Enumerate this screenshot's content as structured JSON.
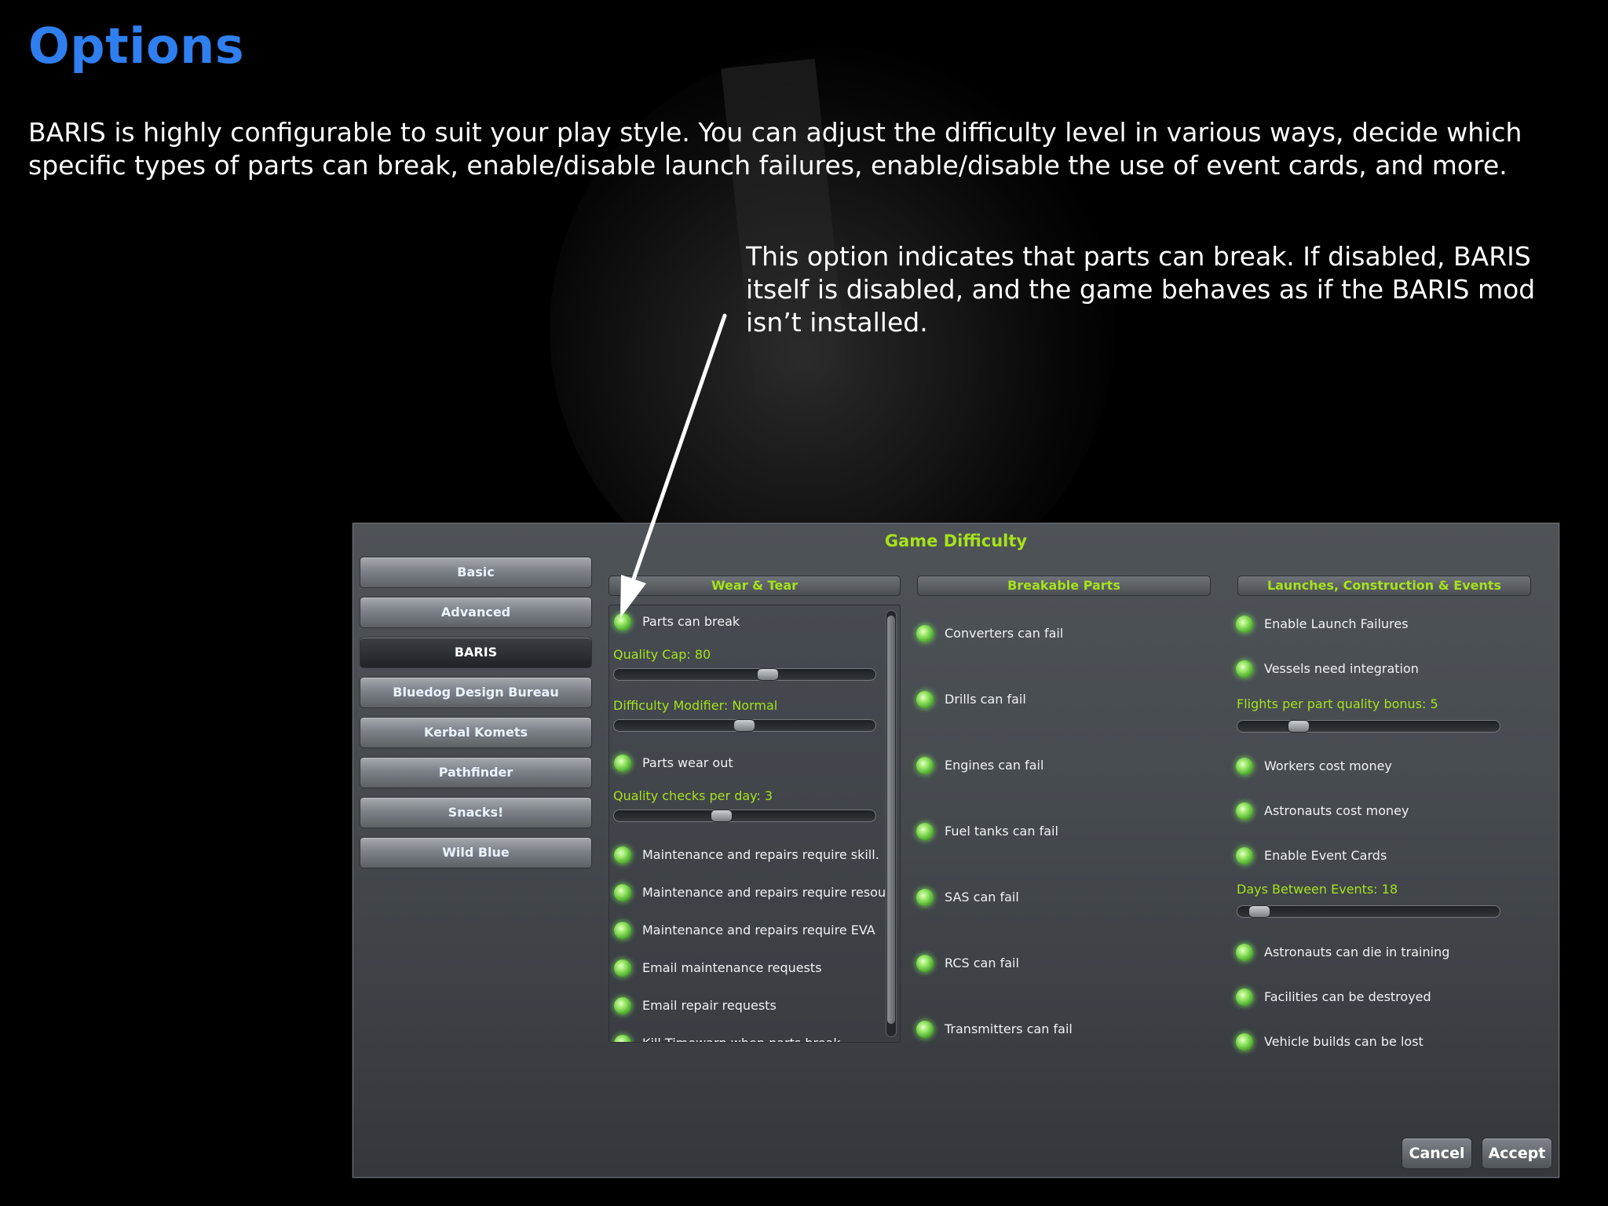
{
  "page": {
    "title": "Options",
    "intro": "BARIS is highly configurable to suit your play style.  You can adjust the difficulty level in various ways, decide which specific types of parts can break, enable/disable launch failures, enable/disable the use of event cards, and more.",
    "callout": "This option indicates that parts can break. If disabled, BARIS itself is disabled, and the game behaves as if the BARIS mod isn’t installed."
  },
  "dialog": {
    "title": "Game Difficulty",
    "tabs": [
      "Basic",
      "Advanced",
      "BARIS",
      "Bluedog Design Bureau",
      "Kerbal Komets",
      "Pathfinder",
      "Snacks!",
      "Wild Blue"
    ],
    "active_tab": "BARIS",
    "columns": {
      "wear": {
        "header": "Wear & Tear",
        "parts_can_break": "Parts can break",
        "quality_cap": {
          "label": "Quality Cap: 80",
          "value": 80
        },
        "difficulty_modifier": {
          "label": "Difficulty Modifier: Normal",
          "value": "Normal"
        },
        "parts_wear_out": "Parts wear out",
        "quality_checks": {
          "label": "Quality checks per day: 3",
          "value": 3
        },
        "toggles": [
          "Maintenance and repairs require skill.",
          "Maintenance and repairs require resou",
          "Maintenance and repairs require EVA",
          "Email maintenance requests",
          "Email repair requests",
          "Kill Timewarp when parts break"
        ]
      },
      "breakable": {
        "header": "Breakable Parts",
        "toggles": [
          "Converters can fail",
          "Drills can fail",
          "Engines can fail",
          "Fuel tanks can fail",
          "SAS can fail",
          "RCS can fail",
          "Transmitters can fail"
        ]
      },
      "launches": {
        "header": "Launches, Construction & Events",
        "enable_launch_failures": "Enable Launch Failures",
        "vessels_need_integration": "Vessels need integration",
        "flights_bonus": {
          "label": "Flights per part quality bonus: 5",
          "value": 5
        },
        "workers_cost_money": "Workers cost money",
        "astronauts_cost_money": "Astronauts cost money",
        "enable_event_cards": "Enable Event Cards",
        "days_between_events": {
          "label": "Days Between Events: 18",
          "value": 18
        },
        "astronauts_can_die": "Astronauts can die in training",
        "facilities_destroyed": "Facilities can be destroyed",
        "vehicle_builds_lost": "Vehicle builds can be lost"
      }
    },
    "buttons": {
      "cancel": "Cancel",
      "accept": "Accept"
    }
  },
  "colors": {
    "title_blue": "#2f7ff0",
    "accent_green": "#a6e21a",
    "led_green": "#54b332"
  },
  "icons": {
    "toggle": "green-led-toggle-icon",
    "arrow": "callout-arrow"
  }
}
